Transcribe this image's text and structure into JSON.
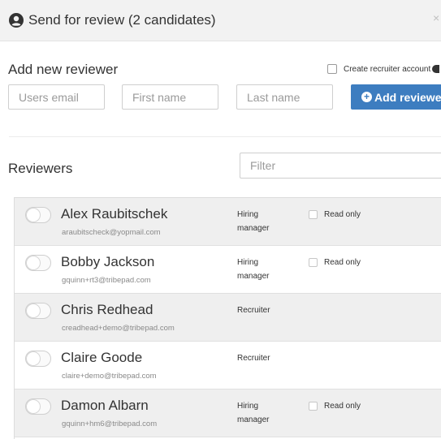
{
  "header": {
    "title": "Send for review (2 candidates)",
    "icon": "user-circle-icon",
    "close_label": "×"
  },
  "add_reviewer": {
    "section_title": "Add new reviewer",
    "create_account_label": "Create recruiter account",
    "email_placeholder": "Users email",
    "first_name_placeholder": "First name",
    "last_name_placeholder": "Last name",
    "button_label": "Add reviewer",
    "button_color": "#3d7dc0"
  },
  "reviewers": {
    "section_title": "Reviewers",
    "filter_placeholder": "Filter",
    "items": [
      {
        "name": "Alex Raubitschek",
        "email": "araubitscheck@yopmail.com",
        "role_line1": "Hiring",
        "role_line2": "manager",
        "read_only_label": "Read only"
      },
      {
        "name": "Bobby Jackson",
        "email": "gquinn+rt3@tribepad.com",
        "role_line1": "Hiring",
        "role_line2": "manager",
        "read_only_label": "Read only"
      },
      {
        "name": "Chris Redhead",
        "email": "creadhead+demo@tribepad.com",
        "role_line1": "Recruiter",
        "role_line2": ""
      },
      {
        "name": "Claire Goode",
        "email": "claire+demo@tribepad.com",
        "role_line1": "Recruiter",
        "role_line2": ""
      },
      {
        "name": "Damon Albarn",
        "email": "gquinn+hm6@tribepad.com",
        "role_line1": "Hiring",
        "role_line2": "manager",
        "read_only_label": "Read only"
      }
    ]
  }
}
